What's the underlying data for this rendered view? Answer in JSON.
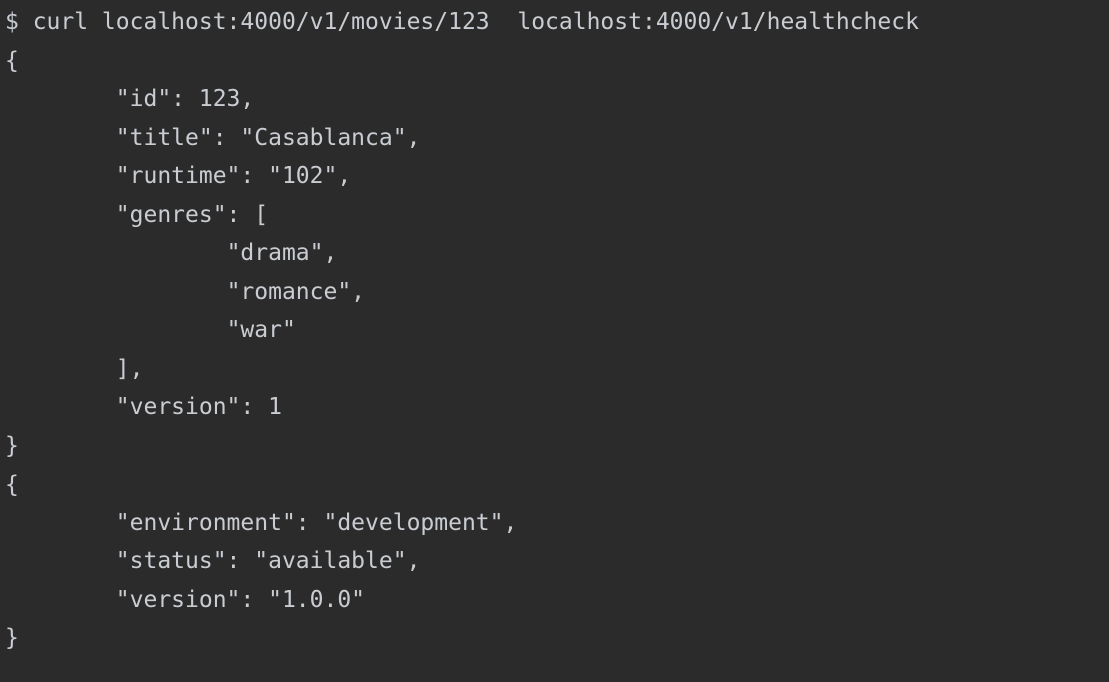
{
  "terminal": {
    "lines": [
      "$ curl localhost:4000/v1/movies/123  localhost:4000/v1/healthcheck",
      "{",
      "\t\"id\": 123,",
      "\t\"title\": \"Casablanca\",",
      "\t\"runtime\": \"102\",",
      "\t\"genres\": [",
      "\t\t\"drama\",",
      "\t\t\"romance\",",
      "\t\t\"war\"",
      "\t],",
      "\t\"version\": 1",
      "}",
      "{",
      "\t\"environment\": \"development\",",
      "\t\"status\": \"available\",",
      "\t\"version\": \"1.0.0\"",
      "}"
    ]
  },
  "colors": {
    "background": "#2b2b2b",
    "text": "#c9cdd2"
  }
}
